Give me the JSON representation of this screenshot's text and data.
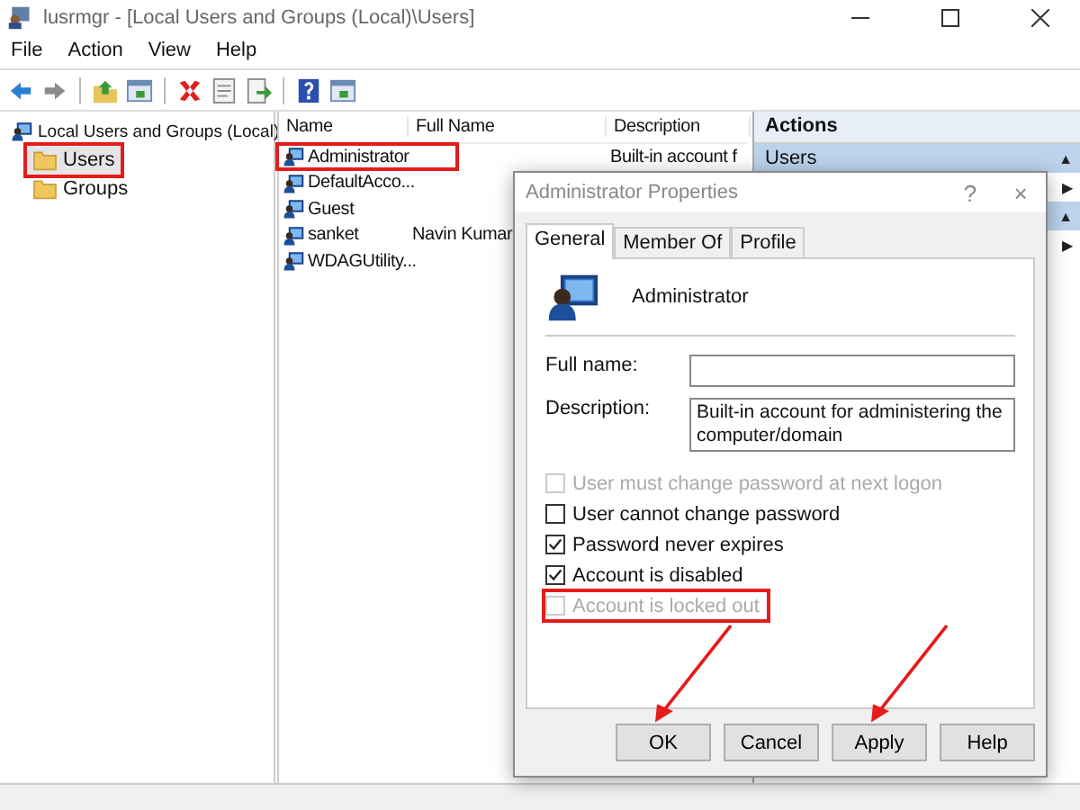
{
  "window": {
    "title": "lusrmgr - [Local Users and Groups (Local)\\Users]"
  },
  "menu": [
    "File",
    "Action",
    "View",
    "Help"
  ],
  "toolbar": [
    {
      "kind": "back"
    },
    {
      "kind": "forward"
    },
    {
      "kind": "separator"
    },
    {
      "kind": "up"
    },
    {
      "kind": "tree"
    },
    {
      "kind": "separator"
    },
    {
      "kind": "delete"
    },
    {
      "kind": "properties"
    },
    {
      "kind": "export"
    },
    {
      "kind": "separator"
    },
    {
      "kind": "help"
    },
    {
      "kind": "pane"
    }
  ],
  "tree": {
    "label": "Local Users and Groups (Local)",
    "children": [
      {
        "label": "Users",
        "selected": true,
        "highlighted": true
      },
      {
        "label": "Groups",
        "selected": false,
        "highlighted": false
      }
    ]
  },
  "list": {
    "columns": [
      "Name",
      "Full Name",
      "Description"
    ],
    "rows": [
      {
        "name": "Administrator",
        "description": "Built-in account f",
        "highlighted": true
      },
      {
        "name": "DefaultAcco...",
        "highlighted": false
      },
      {
        "name": "Guest",
        "highlighted": false
      },
      {
        "name": "sanket",
        "full_name": "Navin Kumar",
        "highlighted": false
      },
      {
        "name": "WDAGUtility...",
        "highlighted": false
      }
    ]
  },
  "actions": {
    "title": "Actions",
    "rows": [
      {
        "label": "Users",
        "glyph": "▲",
        "selected": true
      },
      {
        "glyph": "▶",
        "selected": false
      },
      {
        "glyph": "▲",
        "selected": true
      },
      {
        "glyph": "▶",
        "selected": false
      }
    ]
  },
  "dialog": {
    "title": "Administrator Properties",
    "help": "?",
    "close": "×",
    "tabs": [
      {
        "label": "General",
        "selected": true
      },
      {
        "label": "Member Of",
        "selected": false
      },
      {
        "label": "Profile",
        "selected": false
      }
    ],
    "user": "Administrator",
    "fields": [
      {
        "label": "Full name:"
      },
      {
        "label": "Description:",
        "value": "Built-in account for administering the computer/domain"
      }
    ],
    "checkboxes": [
      {
        "label": "User must change password at next logon",
        "checked": false,
        "disabled": true,
        "highlighted": false
      },
      {
        "label": "User cannot change password",
        "checked": false,
        "disabled": false,
        "highlighted": false
      },
      {
        "label": "Password never expires",
        "checked": true,
        "disabled": false,
        "highlighted": false
      },
      {
        "label": "Account is disabled",
        "checked": true,
        "disabled": false,
        "highlighted": false
      },
      {
        "label": "Account is locked out",
        "checked": false,
        "disabled": true,
        "highlighted": true
      }
    ],
    "buttons": [
      {
        "label": "OK",
        "pointed": true
      },
      {
        "label": "Cancel",
        "pointed": false
      },
      {
        "label": "Apply",
        "pointed": true
      },
      {
        "label": "Help",
        "pointed": false
      }
    ]
  }
}
